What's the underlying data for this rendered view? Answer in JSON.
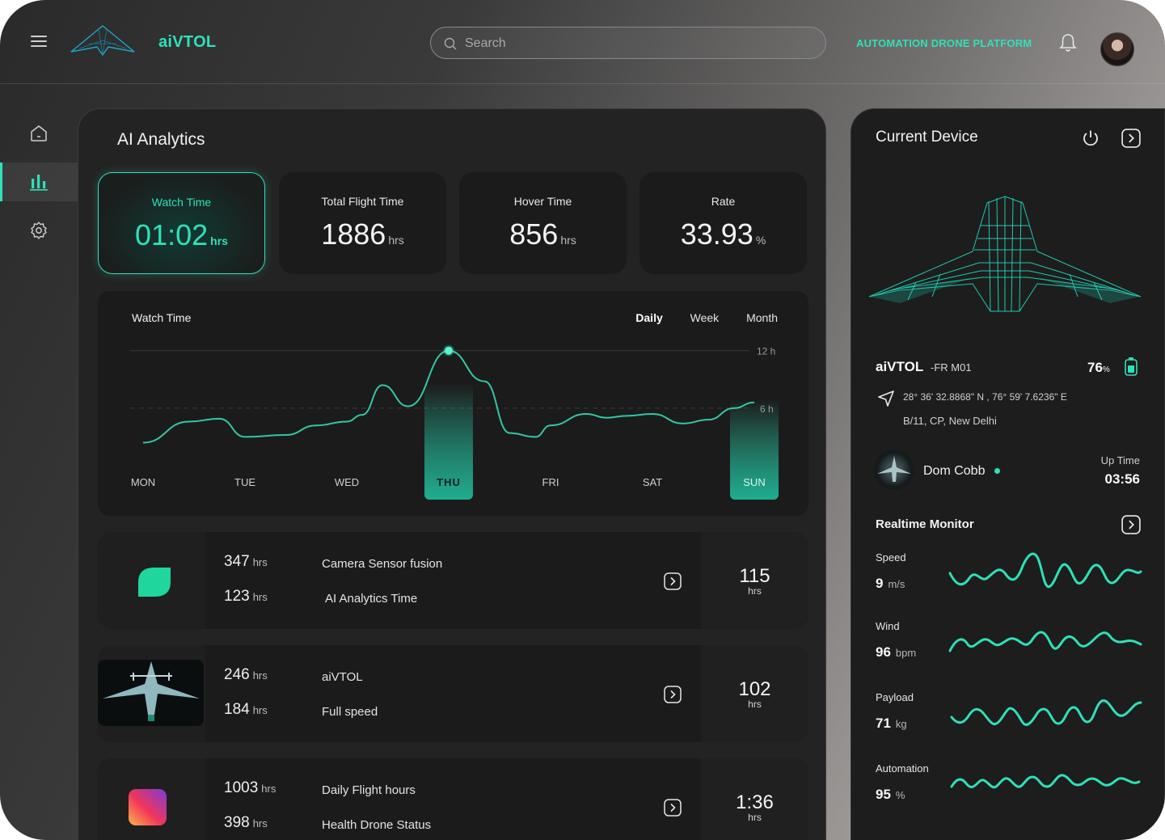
{
  "header": {
    "brand": "aiVTOL",
    "search_placeholder": "Search",
    "platform_label": "AUTOMATION DRONE PLATFORM"
  },
  "colors": {
    "accent": "#2fe0b8",
    "card": "#1b1b1b",
    "panel": "#232323"
  },
  "sidebar": {
    "items": [
      {
        "icon": "home-icon",
        "active": false
      },
      {
        "icon": "analytics-icon",
        "active": true
      },
      {
        "icon": "settings-icon",
        "active": false
      }
    ]
  },
  "analytics": {
    "title": "AI Analytics",
    "stats": [
      {
        "label": "Watch Time",
        "value": "01:02",
        "unit": "hrs"
      },
      {
        "label": "Total Flight Time",
        "value": "1886",
        "unit": "hrs"
      },
      {
        "label": "Hover Time",
        "value": "856",
        "unit": "hrs"
      },
      {
        "label": "Rate",
        "value": "33.93",
        "unit": "%"
      }
    ],
    "chart": {
      "title": "Watch Time",
      "tabs": [
        "Daily",
        "Week",
        "Month"
      ],
      "active_tab": "Daily",
      "y_ticks": [
        "12 h",
        "6 h"
      ],
      "highlighted_days": [
        "THU",
        "SUN"
      ]
    },
    "rows": [
      {
        "v1": "347",
        "u1": "hrs",
        "v2": "123",
        "u2": "hrs",
        "d1": "Camera Sensor fusion",
        "d2": "AI Analytics Time",
        "total": "115",
        "total_unit": "hrs"
      },
      {
        "v1": "246",
        "u1": "hrs",
        "v2": "184",
        "u2": "hrs",
        "d1": "aiVTOL",
        "d2": "Full speed",
        "total": "102",
        "total_unit": "hrs"
      },
      {
        "v1": "1003",
        "u1": "hrs",
        "v2": "398",
        "u2": "hrs",
        "d1": "Daily Flight hours",
        "d2": "Health Drone Status",
        "total": "1:36",
        "total_unit": "hrs"
      }
    ]
  },
  "chart_data": {
    "type": "line",
    "title": "Watch Time",
    "x": [
      "MON",
      "TUE",
      "WED",
      "THU",
      "FRI",
      "SAT",
      "SUN"
    ],
    "series": [
      {
        "values": [
          3.6,
          3.0,
          4.6,
          12.0,
          3.0,
          6.2,
          6.6
        ]
      }
    ],
    "ylim": [
      0,
      14
    ],
    "yticks": [
      6,
      12
    ],
    "highlight": [
      "THU",
      "SUN"
    ]
  },
  "device": {
    "title": "Current Device",
    "name": "aiVTOL",
    "model": "-FR M01",
    "battery_value": "76",
    "battery_unit": "%",
    "coords": "28° 36' 32.8868\" N , 76° 59' 7.6236\" E",
    "address": "B/11, CP, New Delhi",
    "pilot": "Dom Cobb",
    "uptime_label": "Up Time",
    "uptime": "03:56",
    "monitor_title": "Realtime Monitor",
    "metrics": [
      {
        "label": "Speed",
        "value": "9",
        "unit": "m/s"
      },
      {
        "label": "Wind",
        "value": "96",
        "unit": "bpm"
      },
      {
        "label": "Payload",
        "value": "71",
        "unit": "kg"
      },
      {
        "label": "Automation",
        "value": "95",
        "unit": "%"
      }
    ]
  }
}
